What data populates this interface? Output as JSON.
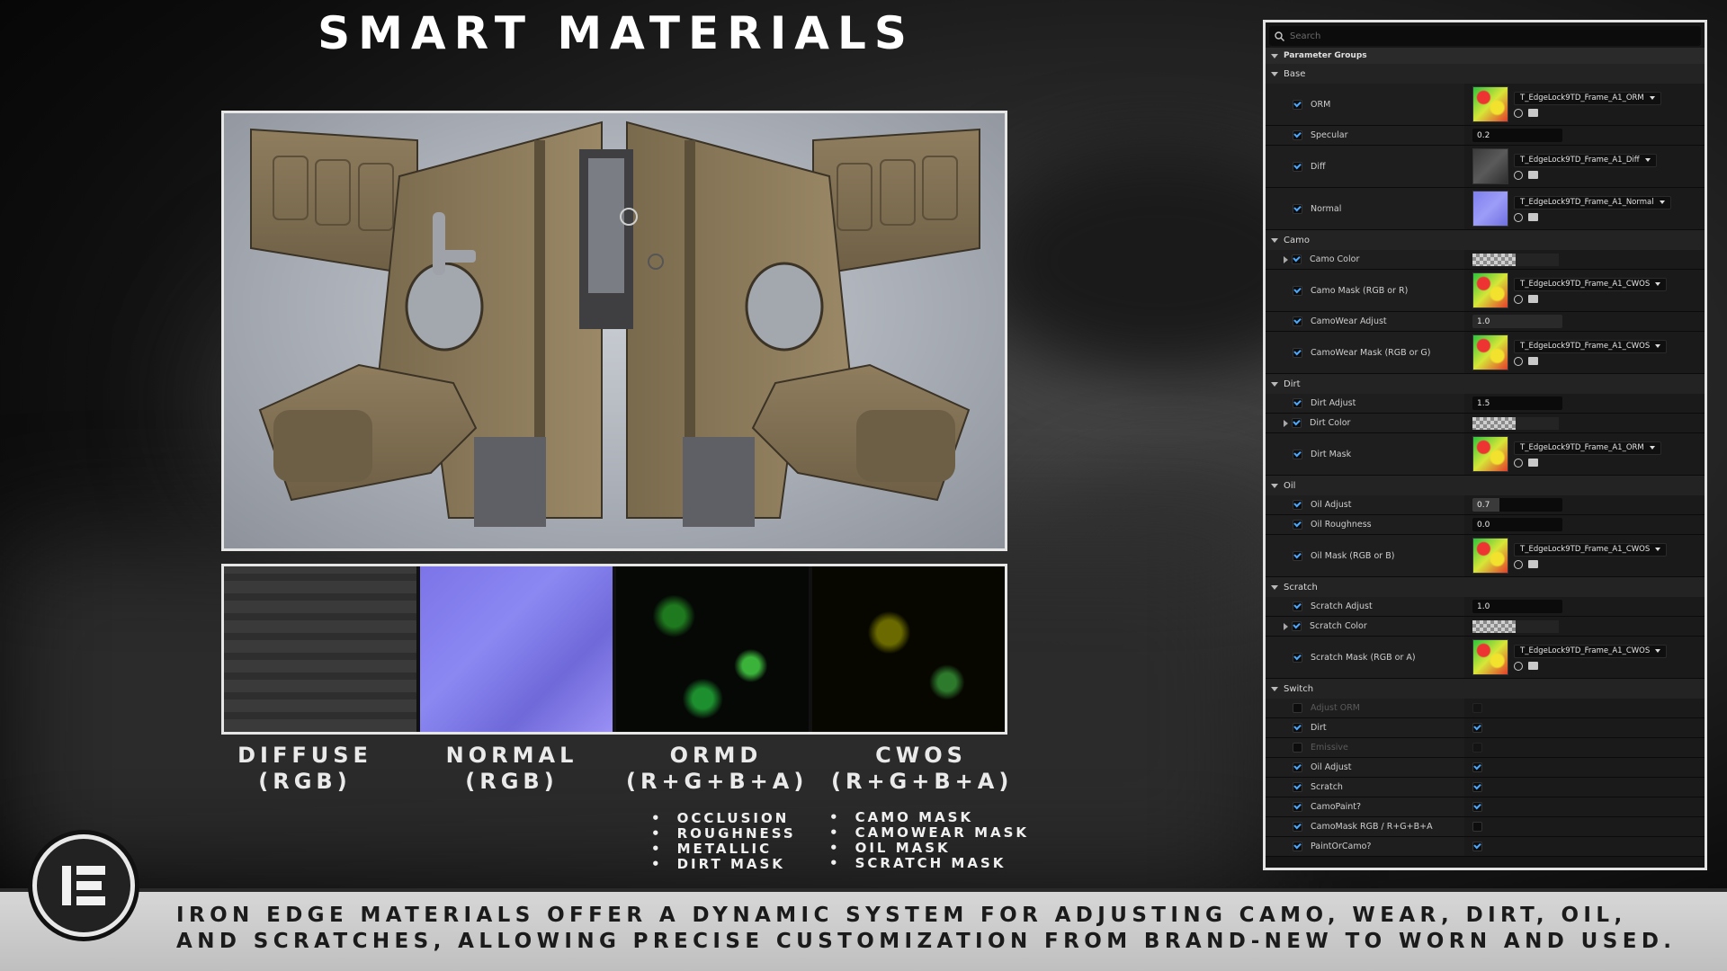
{
  "title": "SMART MATERIALS",
  "textures": [
    {
      "name": "DIFFUSE",
      "channels": "(RGB)"
    },
    {
      "name": "NORMAL",
      "channels": "(RGB)"
    },
    {
      "name": "ORMD",
      "channels": "(R+G+B+A)"
    },
    {
      "name": "CWOS",
      "channels": "(R+G+B+A)"
    }
  ],
  "ormd_bullets": [
    "OCCLUSION",
    "ROUGHNESS",
    "METALLIC",
    "DIRT MASK"
  ],
  "cwos_bullets": [
    "CAMO MASK",
    "CAMOWEAR MASK",
    "OIL MASK",
    "SCRATCH MASK"
  ],
  "footer": {
    "line1": "IRON EDGE MATERIALS OFFER A DYNAMIC SYSTEM FOR ADJUSTING CAMO, WEAR, DIRT, OIL,",
    "line2": "AND SCRATCHES, ALLOWING PRECISE CUSTOMIZATION FROM BRAND-NEW TO WORN AND USED."
  },
  "logo": {
    "text": "IE"
  },
  "panel": {
    "search_placeholder": "Search",
    "parameter_groups_label": "Parameter Groups",
    "groups": {
      "base": "Base",
      "camo": "Camo",
      "dirt": "Dirt",
      "oil": "Oil",
      "scratch": "Scratch",
      "switch": "Switch"
    },
    "params": {
      "orm": {
        "label": "ORM",
        "asset": "T_EdgeLock9TD_Frame_A1_ORM"
      },
      "specular": {
        "label": "Specular",
        "value": "0.2"
      },
      "diff": {
        "label": "Diff",
        "asset": "T_EdgeLock9TD_Frame_A1_Diff"
      },
      "normal": {
        "label": "Normal",
        "asset": "T_EdgeLock9TD_Frame_A1_Normal"
      },
      "camo_color": {
        "label": "Camo Color"
      },
      "camo_mask": {
        "label": "Camo Mask (RGB or R)",
        "asset": "T_EdgeLock9TD_Frame_A1_CWOS"
      },
      "camowear_adjust": {
        "label": "CamoWear Adjust",
        "value": "1.0"
      },
      "camowear_mask": {
        "label": "CamoWear Mask (RGB or G)",
        "asset": "T_EdgeLock9TD_Frame_A1_CWOS"
      },
      "dirt_adjust": {
        "label": "Dirt Adjust",
        "value": "1.5"
      },
      "dirt_color": {
        "label": "Dirt Color"
      },
      "dirt_mask": {
        "label": "Dirt Mask",
        "asset": "T_EdgeLock9TD_Frame_A1_ORM"
      },
      "oil_adjust": {
        "label": "Oil Adjust",
        "value": "0.7"
      },
      "oil_roughness": {
        "label": "Oil Roughness",
        "value": "0.0"
      },
      "oil_mask": {
        "label": "Oil Mask (RGB or B)",
        "asset": "T_EdgeLock9TD_Frame_A1_CWOS"
      },
      "scratch_adjust": {
        "label": "Scratch Adjust",
        "value": "1.0"
      },
      "scratch_color": {
        "label": "Scratch Color"
      },
      "scratch_mask": {
        "label": "Scratch Mask (RGB or A)",
        "asset": "T_EdgeLock9TD_Frame_A1_CWOS"
      }
    },
    "switches": [
      {
        "label": "Adjust ORM",
        "enabled": false,
        "checked": false
      },
      {
        "label": "Dirt",
        "enabled": true,
        "checked": true
      },
      {
        "label": "Emissive",
        "enabled": false,
        "checked": false
      },
      {
        "label": "Oil Adjust",
        "enabled": true,
        "checked": true
      },
      {
        "label": "Scratch",
        "enabled": true,
        "checked": true
      },
      {
        "label": "CamoPaint?",
        "enabled": true,
        "checked": true
      },
      {
        "label": "CamoMask RGB / R+G+B+A",
        "enabled": true,
        "checked": false
      },
      {
        "label": "PaintOrCamo?",
        "enabled": true,
        "checked": true
      }
    ]
  }
}
